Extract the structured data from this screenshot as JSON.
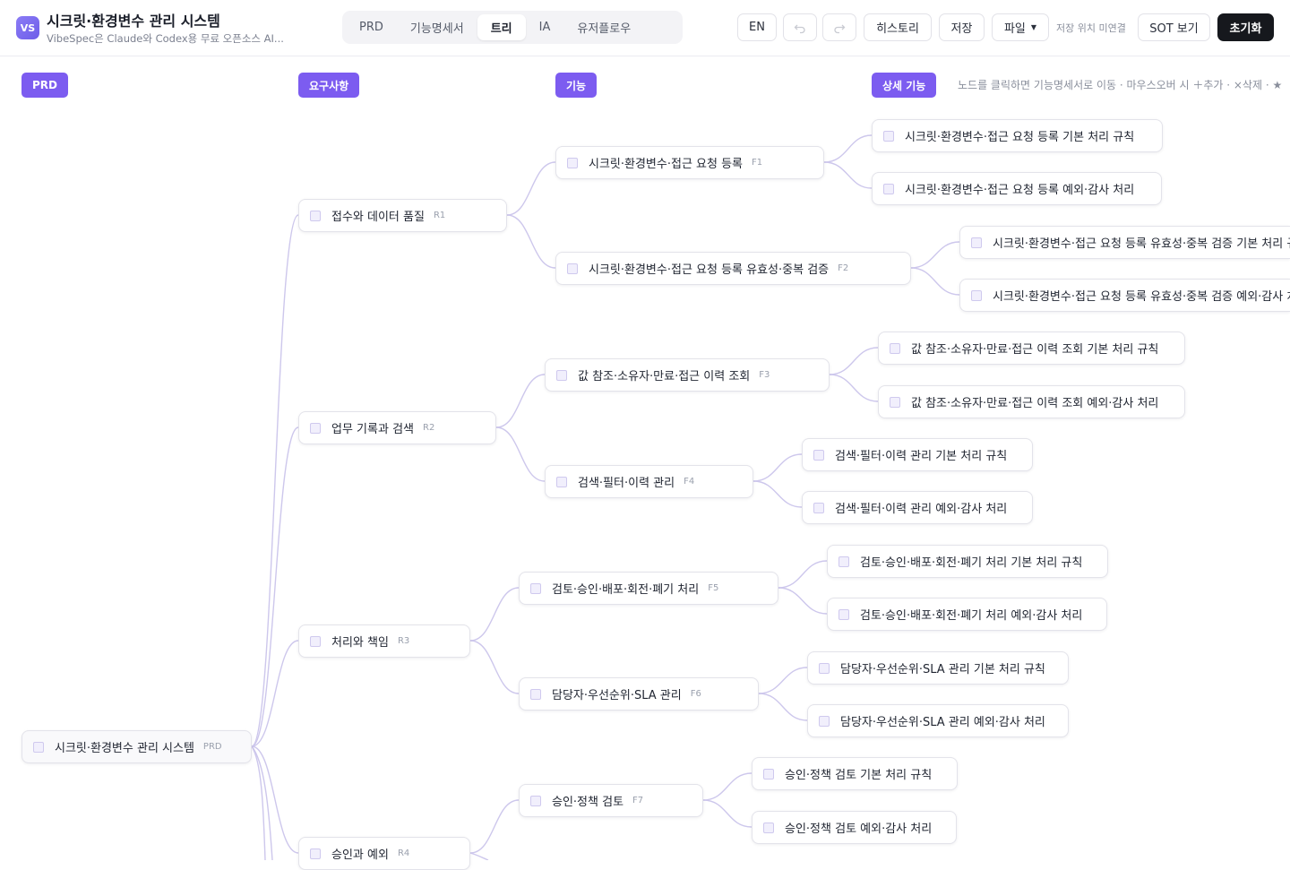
{
  "header": {
    "logo": "VS",
    "title": "시크릿·환경변수 관리 시스템",
    "subtitle": "VibeSpec은 Claude와 Codex용 무료 오픈소스 AI...",
    "tabs": [
      {
        "label": "PRD"
      },
      {
        "label": "기능명세서"
      },
      {
        "label": "트리",
        "active": true
      },
      {
        "label": "IA"
      },
      {
        "label": "유저플로우"
      }
    ],
    "lang_button": "EN",
    "undo_icon": "undo-icon",
    "redo_icon": "redo-icon",
    "history_button": "히스토리",
    "save_button": "저장",
    "file_button": "파일",
    "save_location": "저장 위치 미연결",
    "sot_button": "SOT 보기",
    "reset_button": "초기화"
  },
  "columns": [
    {
      "label": "PRD"
    },
    {
      "label": "요구사항"
    },
    {
      "label": "기능"
    },
    {
      "label": "상세 기능"
    }
  ],
  "hint": "노드를 클릭하면 기능명세서로 이동 · 마우스오버 시 ＋추가 · ×삭제 · ★",
  "colors": {
    "accent": "#7c5cf0",
    "edge": "#cdc7ec",
    "dark": "#16181d"
  },
  "tree": {
    "root": {
      "label": "시크릿·환경변수 관리 시스템",
      "code": "PRD"
    },
    "requirements": [
      {
        "label": "접수와 데이터 품질",
        "code": "R1"
      },
      {
        "label": "업무 기록과 검색",
        "code": "R2"
      },
      {
        "label": "처리와 책임",
        "code": "R3"
      },
      {
        "label": "승인과 예외",
        "code": "R4"
      }
    ],
    "features": [
      {
        "label": "시크릿·환경변수·접근 요청 등록",
        "code": "F1"
      },
      {
        "label": "시크릿·환경변수·접근 요청 등록 유효성·중복 검증",
        "code": "F2"
      },
      {
        "label": "값 참조·소유자·만료·접근 이력 조회",
        "code": "F3"
      },
      {
        "label": "검색·필터·이력 관리",
        "code": "F4"
      },
      {
        "label": "검토·승인·배포·회전·폐기 처리",
        "code": "F5"
      },
      {
        "label": "담당자·우선순위·SLA 관리",
        "code": "F6"
      },
      {
        "label": "승인·정책 검토",
        "code": "F7"
      }
    ],
    "details": [
      {
        "label": "시크릿·환경변수·접근 요청 등록 기본 처리 규칙"
      },
      {
        "label": "시크릿·환경변수·접근 요청 등록 예외·감사 처리"
      },
      {
        "label": "시크릿·환경변수·접근 요청 등록 유효성·중복 검증 기본 처리 규칙"
      },
      {
        "label": "시크릿·환경변수·접근 요청 등록 유효성·중복 검증 예외·감사 처리"
      },
      {
        "label": "값 참조·소유자·만료·접근 이력 조회 기본 처리 규칙"
      },
      {
        "label": "값 참조·소유자·만료·접근 이력 조회 예외·감사 처리"
      },
      {
        "label": "검색·필터·이력 관리 기본 처리 규칙"
      },
      {
        "label": "검색·필터·이력 관리 예외·감사 처리"
      },
      {
        "label": "검토·승인·배포·회전·폐기 처리 기본 처리 규칙"
      },
      {
        "label": "검토·승인·배포·회전·폐기 처리 예외·감사 처리"
      },
      {
        "label": "담당자·우선순위·SLA 관리 기본 처리 규칙"
      },
      {
        "label": "담당자·우선순위·SLA 관리 예외·감사 처리"
      },
      {
        "label": "승인·정책 검토 기본 처리 규칙"
      },
      {
        "label": "승인·정책 검토 예외·감사 처리"
      }
    ]
  }
}
